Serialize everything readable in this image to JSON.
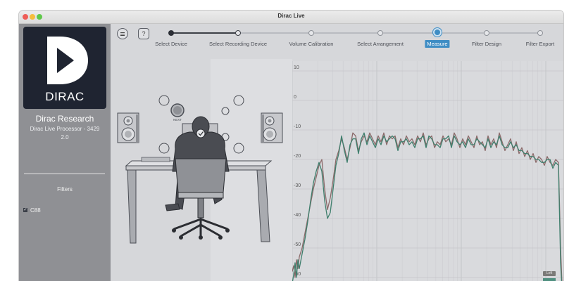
{
  "window": {
    "title": "Dirac Live"
  },
  "sidebar": {
    "logo_text": "DIRAC",
    "company": "Dirac Research",
    "product": "Dirac Live Processor - 3429",
    "version": "2.0",
    "filters_label": "Filters",
    "filter_items": [
      {
        "name": "C88",
        "checked": true
      }
    ]
  },
  "toolbar": {
    "help_label": "?"
  },
  "steps": [
    {
      "label": "Select Device",
      "state": "done"
    },
    {
      "label": "Select Recording Device",
      "state": "done"
    },
    {
      "label": "Volume Calibration",
      "state": "pending"
    },
    {
      "label": "Select Arrangement",
      "state": "pending"
    },
    {
      "label": "Measure",
      "state": "active"
    },
    {
      "label": "Filter Design",
      "state": "pending"
    },
    {
      "label": "Filter Export",
      "state": "pending"
    }
  ],
  "illustration": {
    "next_label": "NEXT"
  },
  "chart_data": {
    "type": "line",
    "y_ticks": [
      "10",
      "0",
      "-10",
      "-20",
      "-30",
      "-40",
      "-50",
      "-60"
    ],
    "ylim": [
      -60,
      10
    ],
    "x_scale": "log",
    "grid": true,
    "legend_label": "Left",
    "series": [
      {
        "color": "#8b6a6a",
        "x": [
          0,
          2,
          4,
          6,
          8,
          10,
          14,
          18,
          22,
          26,
          30,
          34,
          38,
          42,
          46,
          50,
          54,
          58,
          62,
          66,
          70,
          74,
          78,
          82,
          86,
          90,
          94,
          98,
          102,
          106,
          110,
          114,
          118,
          122,
          126,
          130,
          134,
          138,
          142,
          146,
          150,
          154,
          158,
          162,
          166,
          170,
          174,
          178,
          182,
          186,
          190,
          194,
          198,
          202,
          206,
          210,
          214,
          218,
          222,
          226,
          230,
          234,
          238,
          242,
          246,
          250,
          254,
          258,
          262,
          266,
          270,
          274,
          278,
          282,
          286,
          290,
          294,
          298,
          302,
          306,
          310,
          314,
          318,
          322,
          326,
          330,
          334,
          338,
          342,
          346,
          350,
          354,
          358,
          362,
          366,
          370,
          374,
          378,
          381,
          383
        ],
        "values": [
          -58,
          -56,
          -60,
          -54,
          -57,
          -53,
          -50,
          -45,
          -40,
          -35,
          -30,
          -26,
          -22,
          -20,
          -30,
          -37,
          -33,
          -27,
          -20,
          -17,
          -13,
          -16,
          -20,
          -16,
          -11,
          -12,
          -17,
          -14,
          -12,
          -14,
          -11,
          -13,
          -15,
          -12,
          -14,
          -11,
          -15,
          -12,
          -13,
          -12,
          -16,
          -13,
          -15,
          -12,
          -14,
          -13,
          -15,
          -12,
          -14,
          -11,
          -15,
          -13,
          -12,
          -16,
          -14,
          -15,
          -12,
          -14,
          -13,
          -15,
          -11,
          -13,
          -16,
          -13,
          -15,
          -12,
          -14,
          -16,
          -12,
          -15,
          -14,
          -17,
          -12,
          -15,
          -13,
          -16,
          -11,
          -14,
          -17,
          -15,
          -13,
          -17,
          -14,
          -18,
          -16,
          -19,
          -17,
          -20,
          -18,
          -21,
          -19,
          -20,
          -22,
          -19,
          -21,
          -22,
          -20,
          -21,
          -50,
          -62
        ]
      },
      {
        "color": "#3f7f6d",
        "x": [
          0,
          2,
          4,
          6,
          8,
          10,
          14,
          18,
          22,
          26,
          30,
          34,
          38,
          42,
          46,
          50,
          54,
          58,
          62,
          66,
          70,
          74,
          78,
          82,
          86,
          90,
          94,
          98,
          102,
          106,
          110,
          114,
          118,
          122,
          126,
          130,
          134,
          138,
          142,
          146,
          150,
          154,
          158,
          162,
          166,
          170,
          174,
          178,
          182,
          186,
          190,
          194,
          198,
          202,
          206,
          210,
          214,
          218,
          222,
          226,
          230,
          234,
          238,
          242,
          246,
          250,
          254,
          258,
          262,
          266,
          270,
          274,
          278,
          282,
          286,
          290,
          294,
          298,
          302,
          306,
          310,
          314,
          318,
          322,
          326,
          330,
          334,
          338,
          342,
          346,
          350,
          354,
          358,
          362,
          366,
          370,
          374,
          378,
          381,
          383
        ],
        "values": [
          -62,
          -59,
          -55,
          -60,
          -54,
          -57,
          -52,
          -47,
          -41,
          -34,
          -28,
          -24,
          -21,
          -24,
          -34,
          -40,
          -38,
          -30,
          -22,
          -18,
          -12,
          -17,
          -21,
          -15,
          -13,
          -13,
          -18,
          -13,
          -11,
          -15,
          -12,
          -14,
          -16,
          -13,
          -15,
          -12,
          -14,
          -13,
          -12,
          -13,
          -17,
          -14,
          -14,
          -13,
          -15,
          -14,
          -16,
          -13,
          -13,
          -12,
          -16,
          -12,
          -13,
          -15,
          -15,
          -16,
          -13,
          -13,
          -12,
          -16,
          -12,
          -14,
          -15,
          -14,
          -16,
          -13,
          -15,
          -15,
          -13,
          -14,
          -15,
          -16,
          -13,
          -16,
          -14,
          -15,
          -12,
          -15,
          -16,
          -16,
          -14,
          -16,
          -15,
          -17,
          -17,
          -18,
          -18,
          -19,
          -19,
          -20,
          -20,
          -21,
          -21,
          -20,
          -20,
          -23,
          -21,
          -22,
          -55,
          -64
        ]
      }
    ]
  },
  "colors": {
    "accent": "#3f8dc4",
    "sidebar_bg": "#8f9094",
    "logo_bg": "#1f2431",
    "curve_a": "#8b6a6a",
    "curve_b": "#3f7f6d"
  }
}
